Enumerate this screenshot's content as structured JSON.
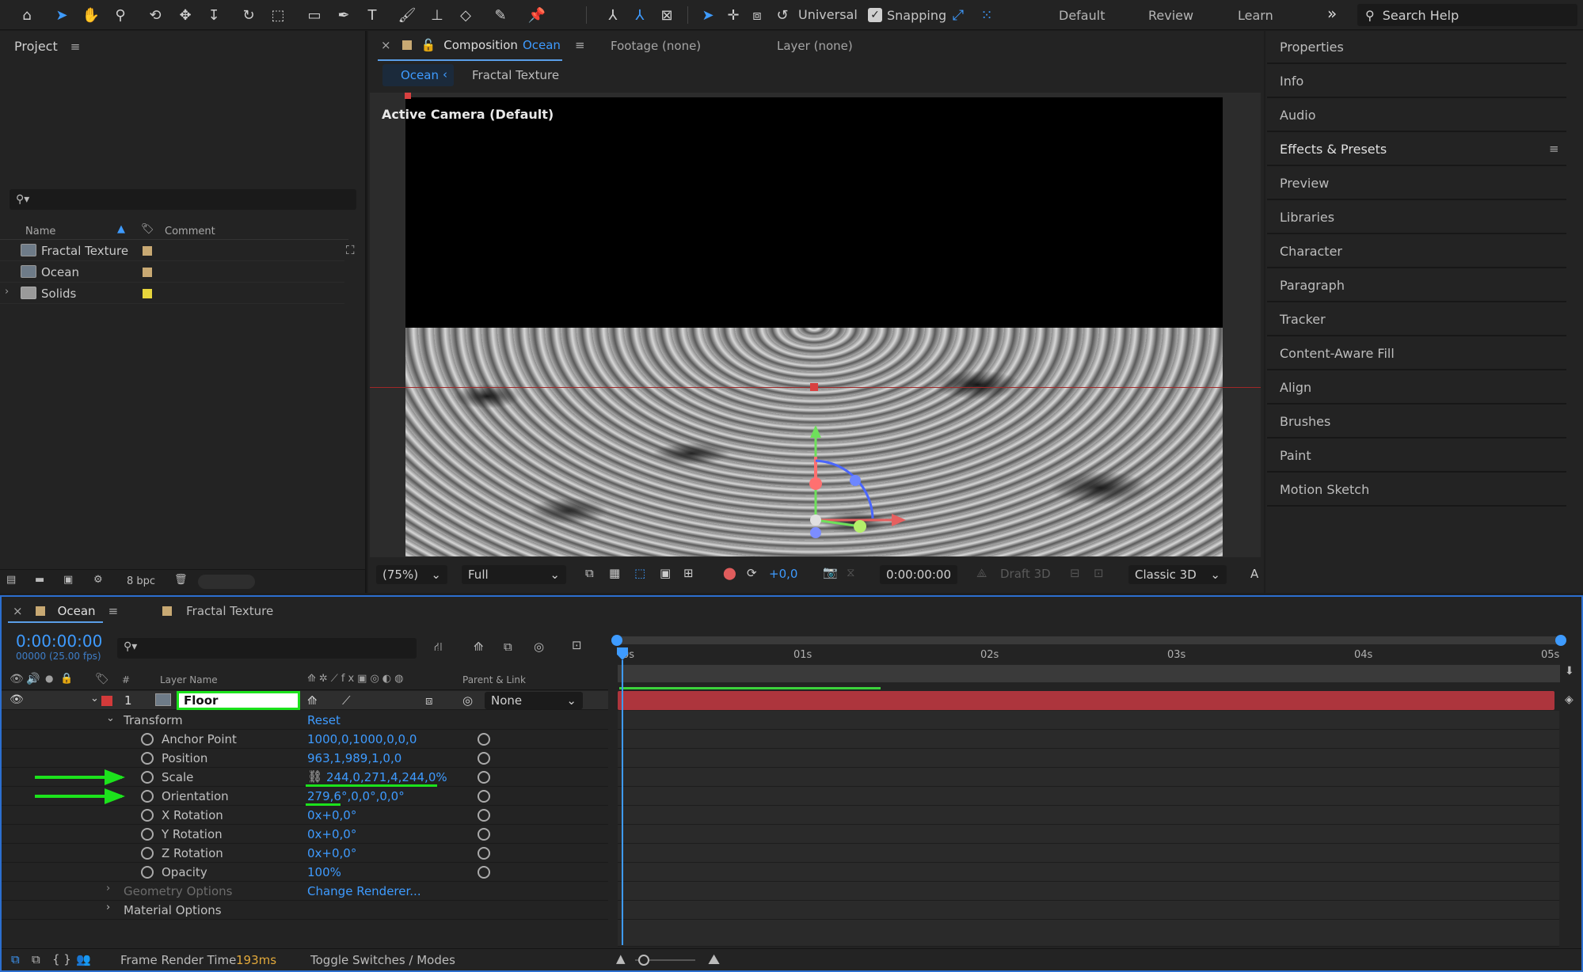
{
  "toolbar": {
    "tools": [
      "home-icon",
      "selection-icon",
      "hand-icon",
      "zoom-icon",
      "orbit-icon",
      "pan-icon",
      "dolly-icon",
      "rotate-icon",
      "pan-behind-icon",
      "rectangle-icon",
      "pen-icon",
      "type-icon",
      "brush-icon",
      "clone-stamp-icon",
      "eraser-icon",
      "roto-brush-icon",
      "puppet-icon"
    ],
    "axis_mode_label": "Universal",
    "snapping_label": "Snapping",
    "workspaces": [
      "Default",
      "Review",
      "Learn"
    ],
    "more_icon": "»",
    "search_placeholder": "Search Help"
  },
  "project": {
    "title": "Project",
    "columns": {
      "name": "Name",
      "comment": "Comment"
    },
    "items": [
      {
        "name": "Fractal Texture",
        "color": "#c8a973"
      },
      {
        "name": "Ocean",
        "color": "#c8a973"
      },
      {
        "name": "Solids",
        "color": "#e6d43c"
      }
    ],
    "bpc": "8 bpc"
  },
  "composition": {
    "tab_prefix": "Composition",
    "tab_name": "Ocean",
    "footage": "Footage (none)",
    "layer": "Layer (none)",
    "breadcrumbs": [
      "Ocean",
      "Fractal Texture"
    ],
    "camera_label": "Active Camera (Default)",
    "zoom": "(75%)",
    "resolution": "Full",
    "exposure": "+0,0",
    "timecode": "0:00:00:00",
    "draft3d": "Draft 3D",
    "renderer": "Classic 3D",
    "extra": "A"
  },
  "right_panels": [
    "Properties",
    "Info",
    "Audio",
    "Effects & Presets",
    "Preview",
    "Libraries",
    "Character",
    "Paragraph",
    "Tracker",
    "Content-Aware Fill",
    "Align",
    "Brushes",
    "Paint",
    "Motion Sketch"
  ],
  "timeline": {
    "comp_tab": "Ocean",
    "other_tab": "Fractal Texture",
    "timecode": "0:00:00:00",
    "fps": "00000 (25.00 fps)",
    "headers": {
      "hash": "#",
      "layer_name": "Layer Name",
      "parent": "Parent & Link"
    },
    "layer": {
      "number": "1",
      "name": "Floor",
      "parent": "None",
      "color": "#d23a3a"
    },
    "transform_label": "Transform",
    "reset_label": "Reset",
    "properties": [
      {
        "name": "Anchor Point",
        "value": "1000,0,1000,0,0,0"
      },
      {
        "name": "Position",
        "value": "963,1,989,1,0,0"
      },
      {
        "name": "Scale",
        "value": "244,0,271,4,244,0%"
      },
      {
        "name": "Orientation",
        "value": "279,6°,0,0°,0,0°"
      },
      {
        "name": "X Rotation",
        "value": "0x+0,0°"
      },
      {
        "name": "Y Rotation",
        "value": "0x+0,0°"
      },
      {
        "name": "Z Rotation",
        "value": "0x+0,0°"
      },
      {
        "name": "Opacity",
        "value": "100%"
      }
    ],
    "geometry_label": "Geometry Options",
    "change_renderer": "Change Renderer...",
    "material_label": "Material Options",
    "ruler": [
      "0s",
      "01s",
      "02s",
      "03s",
      "04s",
      "05s"
    ],
    "footer": {
      "render_label": "Frame Render Time",
      "render_value": "193ms",
      "toggle": "Toggle Switches / Modes"
    }
  }
}
